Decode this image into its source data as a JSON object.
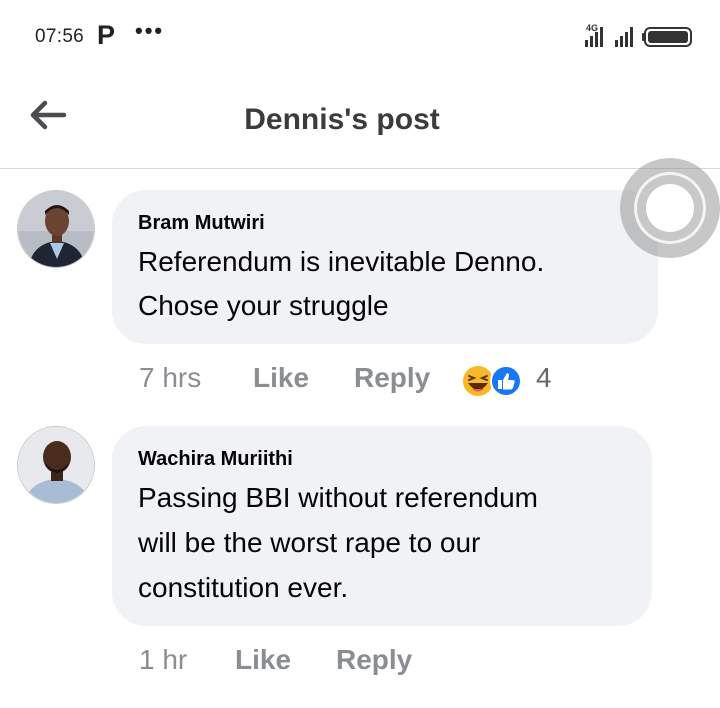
{
  "status_bar": {
    "time": "07:56",
    "app_icon": "P",
    "more": "•••",
    "network": "4G",
    "icons": [
      "signal-icon",
      "signal-icon",
      "battery-icon"
    ]
  },
  "header": {
    "title": "Dennis's post",
    "back_icon": "arrow-left-icon"
  },
  "comments": [
    {
      "author": "Bram Mutwiri",
      "text_lines": [
        "Referendum is inevitable Denno.",
        "Chose your struggle"
      ],
      "time": "7 hrs",
      "like_label": "Like",
      "reply_label": "Reply",
      "reactions": [
        "haha-icon",
        "like-icon"
      ],
      "reaction_count": "4"
    },
    {
      "author": "Wachira Muriithi",
      "text_lines": [
        "Passing BBI without referendum",
        "will be the worst rape to our",
        "constitution ever."
      ],
      "time": "1 hr",
      "like_label": "Like",
      "reply_label": "Reply"
    }
  ],
  "colors": {
    "bubble": "#f0f2f5",
    "meta_text": "#8a8d91",
    "like_blue": "#1877f2",
    "haha_yellow": "#f7b928"
  }
}
